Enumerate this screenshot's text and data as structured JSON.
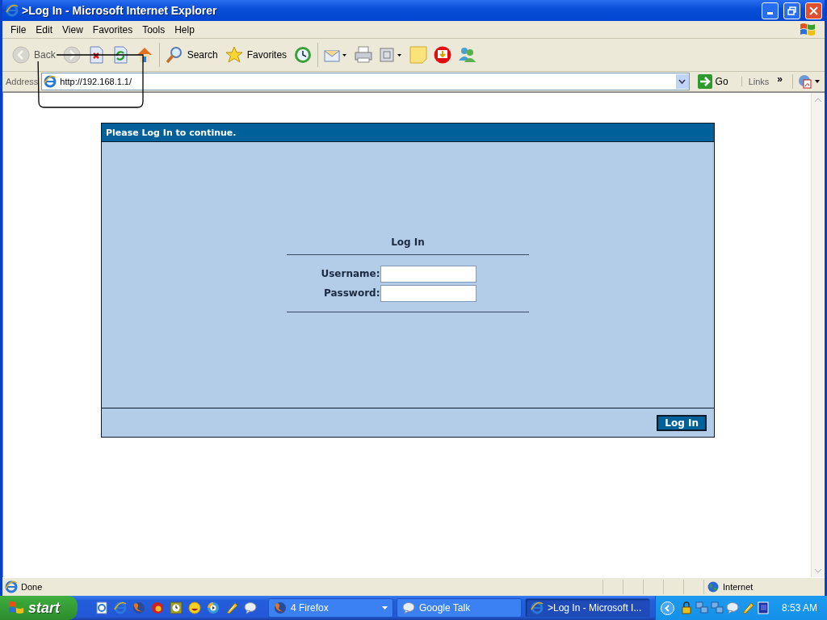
{
  "window": {
    "title": ">Log In - Microsoft Internet Explorer"
  },
  "menu": [
    {
      "label": "File"
    },
    {
      "label": "Edit"
    },
    {
      "label": "View"
    },
    {
      "label": "Favorites"
    },
    {
      "label": "Tools"
    },
    {
      "label": "Help"
    }
  ],
  "toolbar": [
    {
      "kind": "back",
      "label": "Back",
      "disabled": true
    },
    {
      "kind": "forward",
      "disabled": true
    },
    {
      "kind": "stop",
      "disabled": false
    },
    {
      "kind": "refresh",
      "disabled": false
    },
    {
      "kind": "home",
      "disabled": false
    },
    {
      "kind": "search",
      "label": "Search",
      "disabled": false
    },
    {
      "kind": "favorites",
      "label": "Favorites",
      "disabled": false
    },
    {
      "kind": "history",
      "disabled": false
    },
    {
      "kind": "mail",
      "disabled": false
    },
    {
      "kind": "print",
      "disabled": false
    },
    {
      "kind": "edit",
      "disabled": false
    },
    {
      "kind": "note",
      "disabled": false
    },
    {
      "kind": "download",
      "disabled": false
    },
    {
      "kind": "messenger",
      "disabled": false
    }
  ],
  "address": {
    "label": "Address",
    "value": "http://192.168.1.1/",
    "go": "Go",
    "links": "Links",
    "links_more": "»"
  },
  "page": {
    "header": "Please Log In to continue.",
    "form_title": "Log In",
    "fields": [
      {
        "label": "Username:"
      },
      {
        "label": "Password:"
      }
    ],
    "submit": "Log In"
  },
  "status_bar": {
    "text": "Done",
    "zone": "Internet"
  },
  "taskbar": {
    "start": "start",
    "quick_launch": [
      {
        "kind": "ie-edit"
      },
      {
        "kind": "ie"
      },
      {
        "kind": "firefox"
      },
      {
        "kind": "disc"
      },
      {
        "kind": "clock"
      },
      {
        "kind": "smiley"
      },
      {
        "kind": "player"
      },
      {
        "kind": "pen"
      },
      {
        "kind": "chat"
      }
    ],
    "tasks": [
      {
        "kind": "firefox",
        "label": "4 Firefox",
        "selected": false,
        "grouped": true
      },
      {
        "kind": "chat",
        "label": "Google Talk",
        "selected": false,
        "grouped": false
      },
      {
        "kind": "ie",
        "label": ">Log In - Microsoft I...",
        "selected": true,
        "grouped": false
      }
    ],
    "tray": [
      {
        "kind": "lock"
      },
      {
        "kind": "network"
      },
      {
        "kind": "network"
      },
      {
        "kind": "chat"
      },
      {
        "kind": "pen"
      },
      {
        "kind": "book"
      }
    ],
    "clock": "8:53 AM"
  }
}
